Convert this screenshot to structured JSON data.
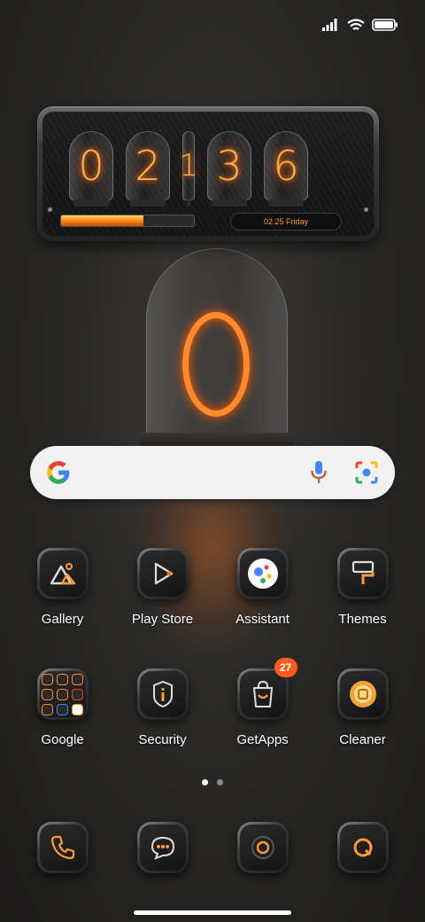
{
  "status_bar": {
    "signal_icon": "signal-icon",
    "wifi_icon": "wifi-icon",
    "battery_icon": "battery-icon"
  },
  "clock_widget": {
    "digits": [
      "0",
      "2",
      "1",
      "3",
      "6"
    ],
    "date": "02.25 Friday",
    "progress": 0.62,
    "accent_color": "#ff8a2a"
  },
  "wallpaper": {
    "big_digit": "0"
  },
  "search_bar": {
    "google_icon": "google-g-icon",
    "mic_icon": "mic-icon",
    "lens_icon": "lens-icon"
  },
  "apps": [
    {
      "label": "Gallery",
      "icon": "gallery-icon"
    },
    {
      "label": "Play Store",
      "icon": "play-store-icon"
    },
    {
      "label": "Assistant",
      "icon": "assistant-icon"
    },
    {
      "label": "Themes",
      "icon": "themes-icon"
    },
    {
      "label": "Google",
      "icon": "google-folder-icon"
    },
    {
      "label": "Security",
      "icon": "security-icon"
    },
    {
      "label": "GetApps",
      "icon": "getapps-icon",
      "badge": "27"
    },
    {
      "label": "Cleaner",
      "icon": "cleaner-icon"
    }
  ],
  "page_indicator": {
    "pages": 2,
    "current": 1
  },
  "dock": [
    {
      "icon": "phone-icon"
    },
    {
      "icon": "messages-icon"
    },
    {
      "icon": "camera-icon"
    },
    {
      "icon": "browser-icon"
    }
  ]
}
